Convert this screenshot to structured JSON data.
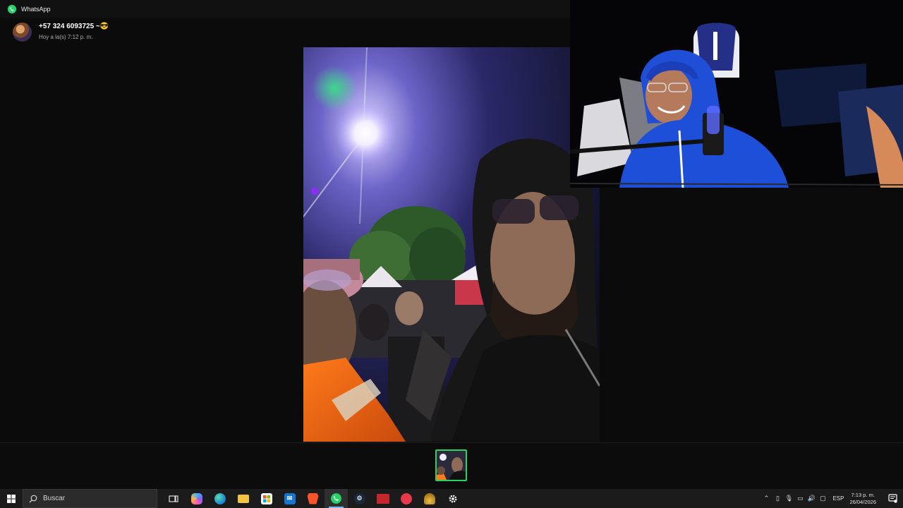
{
  "window": {
    "title": "WhatsApp"
  },
  "viewer": {
    "sender_name": "+57 324 6093725 ~😎",
    "sent_time": "Hoy a la(s) 7:12 p. m."
  },
  "media": {
    "thumbnail_count": 1,
    "selected_index": 0
  },
  "taskbar": {
    "search_placeholder": "Buscar",
    "apps": [
      {
        "name": "task-view",
        "icon": "task-view-icon"
      },
      {
        "name": "copilot",
        "icon": "copilot-icon"
      },
      {
        "name": "edge",
        "icon": "edge-icon"
      },
      {
        "name": "file-explorer",
        "icon": "folder-icon"
      },
      {
        "name": "microsoft-store",
        "icon": "store-icon"
      },
      {
        "name": "outlook",
        "icon": "mail-icon"
      },
      {
        "name": "brave",
        "icon": "brave-icon"
      },
      {
        "name": "whatsapp",
        "icon": "whatsapp-icon",
        "active": true
      },
      {
        "name": "steam",
        "icon": "steam-icon"
      },
      {
        "name": "tracker",
        "icon": "tracker-icon"
      },
      {
        "name": "app-red",
        "icon": "red-circle-icon"
      },
      {
        "name": "app-gold",
        "icon": "gold-helmet-icon"
      },
      {
        "name": "settings",
        "icon": "gear-icon"
      }
    ],
    "tray": {
      "language": "ESP",
      "time": "7:13 p. m.",
      "date": "26/04/2026"
    }
  },
  "colors": {
    "whatsapp_green": "#25d366",
    "taskbar_accent": "#76b9ed"
  }
}
